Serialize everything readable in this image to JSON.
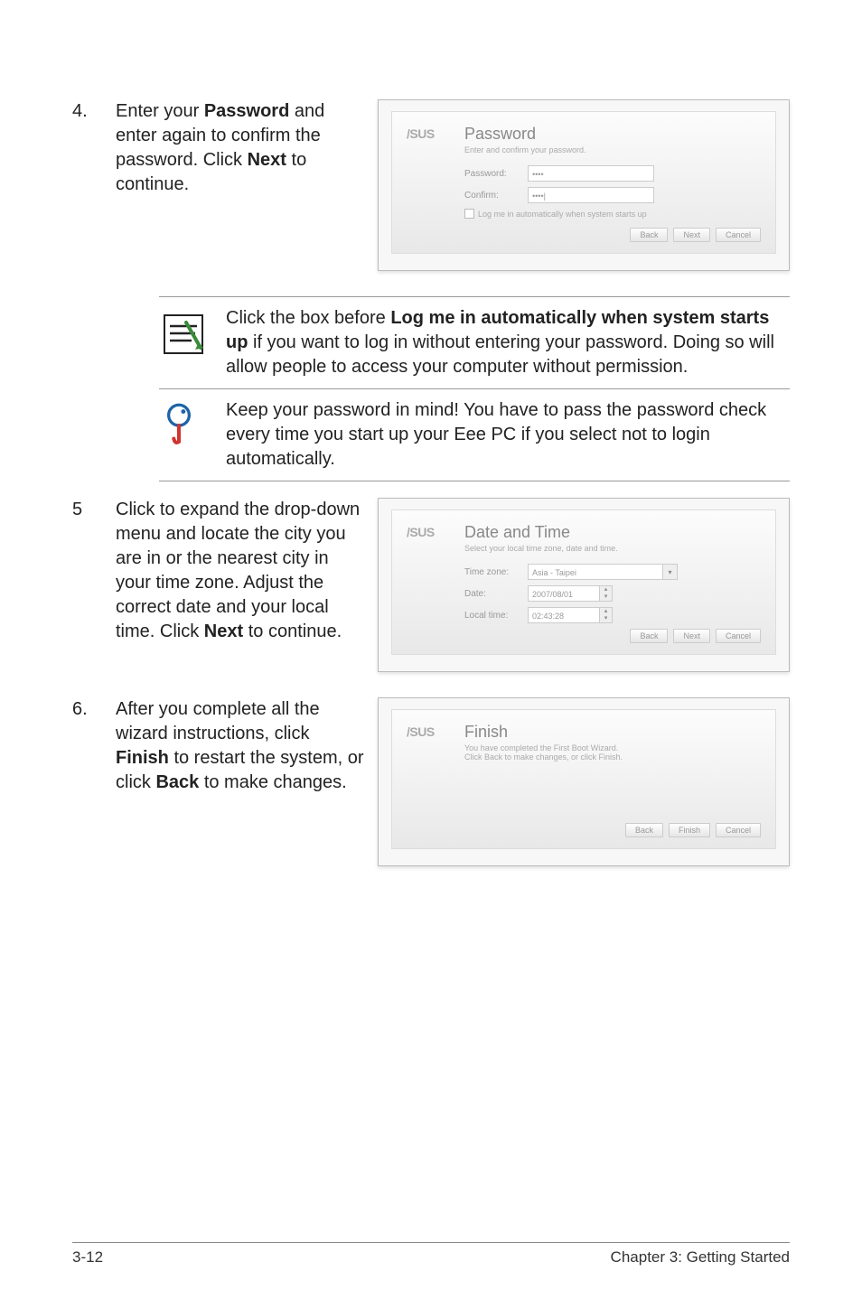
{
  "steps": {
    "s4": {
      "num": "4.",
      "text_pre": "Enter your ",
      "text_bold1": "Password",
      "text_mid": " and enter again to confirm the password. Click ",
      "text_bold2": "Next",
      "text_post": " to continue."
    },
    "s5": {
      "num": "5",
      "text_pre": "Click to expand the drop-down menu and locate the city you are in or the nearest city in your time zone. Adjust the correct date and your local time. Click ",
      "text_bold": "Next",
      "text_post": " to continue."
    },
    "s6": {
      "num": "6.",
      "text_pre": "After you complete all the wizard instructions, click ",
      "text_bold1": "Finish",
      "text_mid": " to restart the system, or click ",
      "text_bold2": "Back",
      "text_post": " to make changes."
    }
  },
  "note1": {
    "pre": "Click the box before ",
    "bold": "Log me in automatically when system starts up",
    "post": " if you want to log in without entering your password. Doing so will allow people to access your computer without permission."
  },
  "note2": {
    "text": "Keep your password in mind! You have to pass the password check every time you start up your Eee PC if you select not to login automatically."
  },
  "shots": {
    "password": {
      "title": "Password",
      "sub": "Enter and confirm your password.",
      "label_password": "Password:",
      "label_confirm": "Confirm:",
      "val_password": "••••",
      "val_confirm": "••••|",
      "check_label": "Log me in automatically when system starts up",
      "btn_back": "Back",
      "btn_next": "Next",
      "btn_cancel": "Cancel"
    },
    "datetime": {
      "title": "Date and Time",
      "sub": "Select your local time zone, date and time.",
      "label_tz": "Time zone:",
      "label_date": "Date:",
      "label_time": "Local time:",
      "val_tz": "Asia - Taipei",
      "val_date": "2007/08/01",
      "val_time": "02:43:28",
      "btn_back": "Back",
      "btn_next": "Next",
      "btn_cancel": "Cancel"
    },
    "finish": {
      "title": "Finish",
      "sub1": "You have completed the First Boot Wizard.",
      "sub2": "Click Back to make changes, or click Finish.",
      "btn_back": "Back",
      "btn_finish": "Finish",
      "btn_cancel": "Cancel"
    }
  },
  "logo": "/SUS",
  "footer": {
    "left": "3-12",
    "right": "Chapter 3: Getting Started"
  }
}
